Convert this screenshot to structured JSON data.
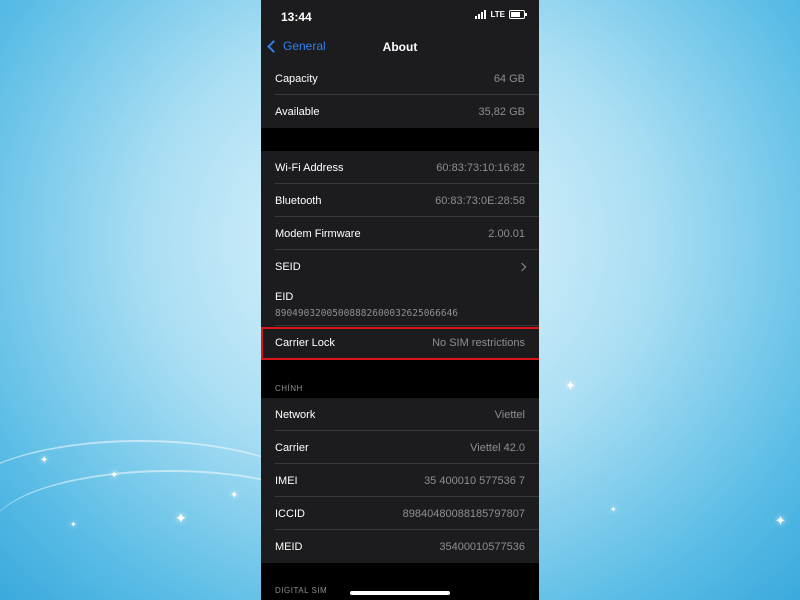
{
  "status_bar": {
    "time": "13:44",
    "network": "LTE"
  },
  "nav": {
    "back_label": "General",
    "title": "About"
  },
  "group1": [
    {
      "label": "Capacity",
      "value": "64 GB"
    },
    {
      "label": "Available",
      "value": "35,82 GB"
    }
  ],
  "group2": [
    {
      "label": "Wi-Fi Address",
      "value": "60:83:73:10:16:82"
    },
    {
      "label": "Bluetooth",
      "value": "60:83:73:0E:28:58"
    },
    {
      "label": "Modem Firmware",
      "value": "2.00.01"
    },
    {
      "label": "SEID",
      "value": ""
    }
  ],
  "eid": {
    "label": "EID",
    "value": "89049032005008882600032625066646"
  },
  "carrier_lock": {
    "label": "Carrier Lock",
    "value": "No SIM restrictions"
  },
  "section_chinh": "CHÍNH",
  "group3": [
    {
      "label": "Network",
      "value": "Viettel"
    },
    {
      "label": "Carrier",
      "value": "Viettel 42.0"
    },
    {
      "label": "IMEI",
      "value": "35 400010 577536 7"
    },
    {
      "label": "ICCID",
      "value": "89840480088185797807"
    },
    {
      "label": "MEID",
      "value": "35400010577536"
    }
  ],
  "section_digital_sim": "DIGITAL SIM",
  "colors": {
    "accent": "#2f80ed",
    "highlight": "#d9151a",
    "cell_bg": "#1c1c1e"
  }
}
